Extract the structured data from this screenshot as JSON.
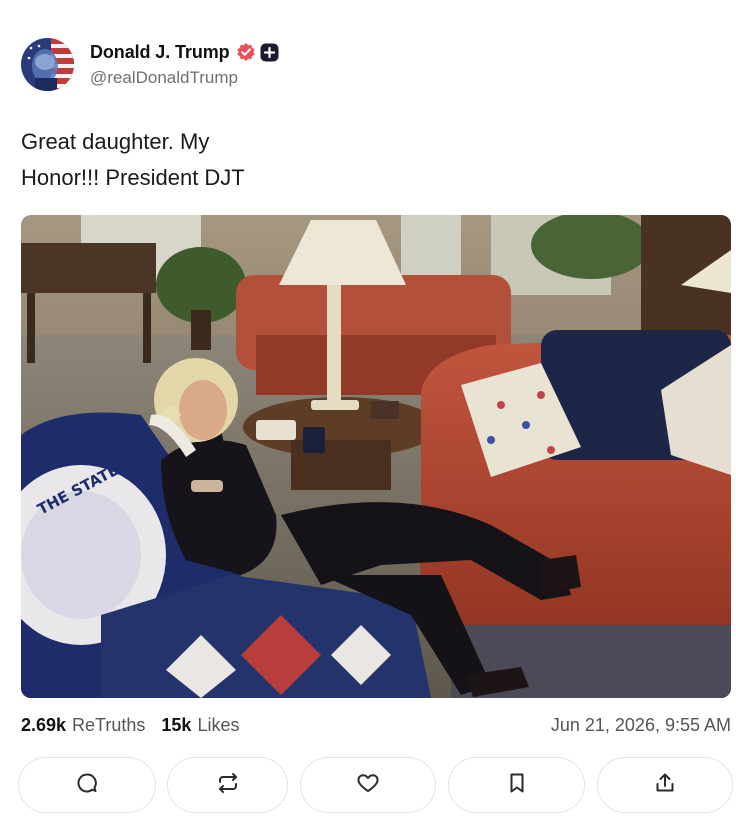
{
  "author": {
    "name": "Donald J. Trump",
    "handle": "@realDonaldTrump",
    "avatar_icon": "flag-portrait-avatar",
    "verified_icon": "verified-badge-icon",
    "verified_color": "#e8505b",
    "plus_icon": "plus-square-icon"
  },
  "post": {
    "text_line1": "Great daughter. My",
    "text_line2": "Honor!!! President DJT",
    "media_description_icon": "photo"
  },
  "stats": {
    "retruths_count": "2.69k",
    "retruths_label": "ReTruths",
    "likes_count": "15k",
    "likes_label": "Likes",
    "timestamp": "Jun 21, 2026, 9:55 AM"
  },
  "actions": [
    {
      "name": "reply",
      "icon": "comment-icon"
    },
    {
      "name": "retruth",
      "icon": "repost-icon"
    },
    {
      "name": "like",
      "icon": "heart-icon"
    },
    {
      "name": "bookmark",
      "icon": "bookmark-icon"
    },
    {
      "name": "share",
      "icon": "share-icon"
    }
  ],
  "colors": {
    "text": "#1a1a1a",
    "muted": "#555555",
    "button_border": "#e4e4e8",
    "icon": "#2b2b2b"
  }
}
